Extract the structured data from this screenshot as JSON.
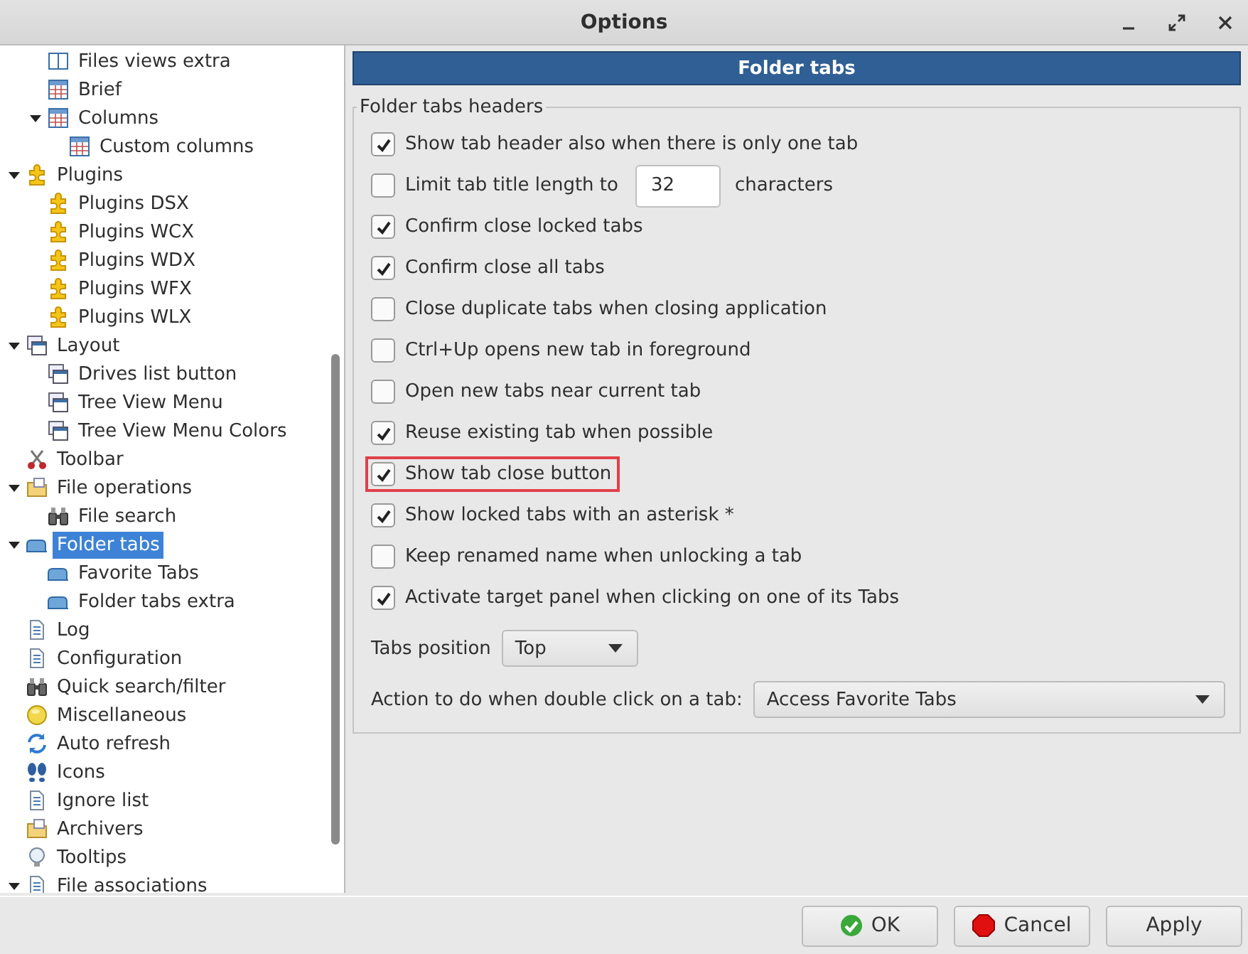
{
  "window": {
    "title": "Options"
  },
  "tree": {
    "items": [
      {
        "children": [
          {
            "label": "Files views extra",
            "kind": "panes",
            "selected": false
          },
          {
            "label": "Brief",
            "kind": "grid",
            "selected": false
          },
          {
            "label": "Columns",
            "kind": "grid",
            "selected": false,
            "expanded": true,
            "children": [
              {
                "label": "Custom columns",
                "kind": "grid",
                "selected": false
              }
            ]
          }
        ]
      },
      {
        "label": "Plugins",
        "kind": "puzzle",
        "selected": false,
        "expanded": true,
        "children": [
          {
            "label": "Plugins DSX",
            "kind": "puzzle",
            "selected": false
          },
          {
            "label": "Plugins WCX",
            "kind": "puzzle",
            "selected": false
          },
          {
            "label": "Plugins WDX",
            "kind": "puzzle",
            "selected": false
          },
          {
            "label": "Plugins WFX",
            "kind": "puzzle",
            "selected": false
          },
          {
            "label": "Plugins WLX",
            "kind": "puzzle",
            "selected": false
          }
        ]
      },
      {
        "label": "Layout",
        "kind": "layout",
        "selected": false,
        "expanded": true,
        "children": [
          {
            "label": "Drives list button",
            "kind": "layout",
            "selected": false
          },
          {
            "label": "Tree View Menu",
            "kind": "layout",
            "selected": false
          },
          {
            "label": "Tree View Menu Colors",
            "kind": "layout",
            "selected": false
          }
        ]
      },
      {
        "label": "Toolbar",
        "kind": "scissors",
        "selected": false
      },
      {
        "label": "File operations",
        "kind": "folder",
        "selected": false,
        "expanded": true,
        "children": [
          {
            "label": "File search",
            "kind": "binoculars",
            "selected": false
          }
        ]
      },
      {
        "label": "Folder tabs",
        "kind": "tab",
        "selected": true,
        "expanded": true,
        "children": [
          {
            "label": "Favorite Tabs",
            "kind": "tab",
            "selected": false
          },
          {
            "label": "Folder tabs extra",
            "kind": "tab",
            "selected": false
          }
        ]
      },
      {
        "label": "Log",
        "kind": "page",
        "selected": false
      },
      {
        "label": "Configuration",
        "kind": "page",
        "selected": false
      },
      {
        "label": "Quick search/filter",
        "kind": "binoculars",
        "selected": false
      },
      {
        "label": "Miscellaneous",
        "kind": "ball",
        "selected": false
      },
      {
        "label": "Auto refresh",
        "kind": "refresh",
        "selected": false
      },
      {
        "label": "Icons",
        "kind": "prints",
        "selected": false
      },
      {
        "label": "Ignore list",
        "kind": "page",
        "selected": false
      },
      {
        "label": "Archivers",
        "kind": "folder",
        "selected": false
      },
      {
        "label": "Tooltips",
        "kind": "bulb",
        "selected": false
      },
      {
        "label": "File associations",
        "kind": "page",
        "selected": false,
        "expanded": true
      }
    ]
  },
  "panel": {
    "title": "Folder tabs",
    "group": {
      "title": "Folder tabs headers",
      "options": [
        {
          "kind": "checkbox",
          "label": "Show tab header also when there is only one tab",
          "checked": true,
          "highlighted": false
        },
        {
          "kind": "number",
          "label": "Limit tab title length to",
          "checked": false,
          "highlighted": false,
          "value": "32",
          "suffix": "characters"
        },
        {
          "kind": "checkbox",
          "label": "Confirm close locked tabs",
          "checked": true,
          "highlighted": false
        },
        {
          "kind": "checkbox",
          "label": "Confirm close all tabs",
          "checked": true,
          "highlighted": false
        },
        {
          "kind": "checkbox",
          "label": "Close duplicate tabs when closing application",
          "checked": false,
          "highlighted": false
        },
        {
          "kind": "checkbox",
          "label": "Ctrl+Up opens new tab in foreground",
          "checked": false,
          "highlighted": false
        },
        {
          "kind": "checkbox",
          "label": "Open new tabs near current tab",
          "checked": false,
          "highlighted": false
        },
        {
          "kind": "checkbox",
          "label": "Reuse existing tab when possible",
          "checked": true,
          "highlighted": false
        },
        {
          "kind": "checkbox",
          "label": "Show tab close button",
          "checked": true,
          "highlighted": true
        },
        {
          "kind": "checkbox",
          "label": "Show locked tabs with an asterisk *",
          "checked": true,
          "highlighted": false
        },
        {
          "kind": "checkbox",
          "label": "Keep renamed name when unlocking a tab",
          "checked": false,
          "highlighted": false
        },
        {
          "kind": "checkbox",
          "label": "Activate target panel when clicking on one of its Tabs",
          "checked": true,
          "highlighted": false
        }
      ],
      "tabs_position": {
        "label": "Tabs position",
        "value": "Top"
      },
      "double_click_action": {
        "label": "Action to do when double click on a tab:",
        "value": "Access Favorite Tabs"
      }
    }
  },
  "buttons": [
    {
      "kind": "ok",
      "label": "OK"
    },
    {
      "kind": "cancel",
      "label": "Cancel"
    },
    {
      "kind": "plain",
      "label": "Apply"
    }
  ]
}
